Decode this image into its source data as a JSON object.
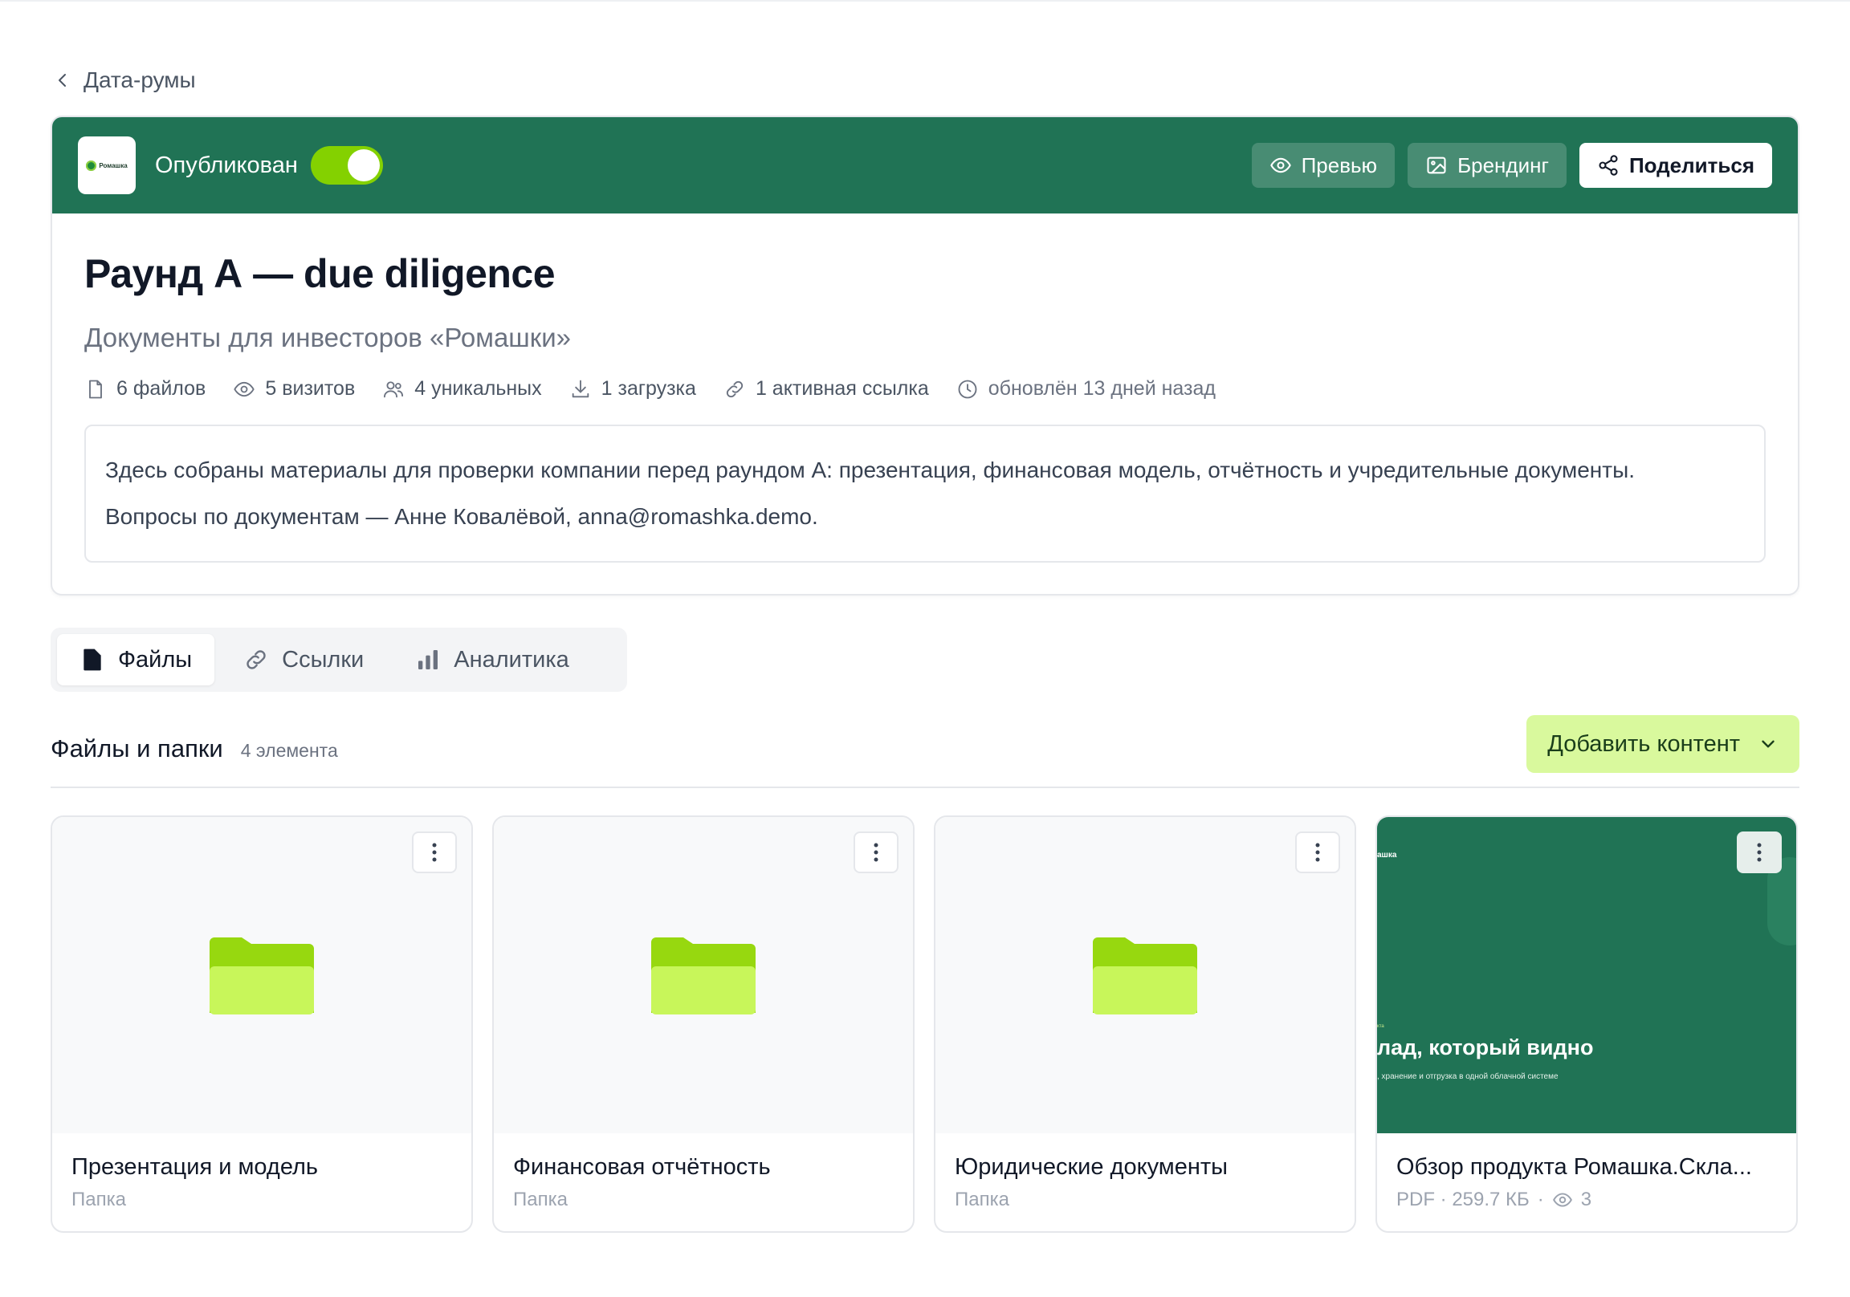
{
  "nav": {
    "back_label": "Дата-румы"
  },
  "room": {
    "logo_text": "Ромашка",
    "status_label": "Опубликован",
    "published": true,
    "actions": {
      "preview": "Превью",
      "branding": "Брендинг",
      "share": "Поделиться"
    },
    "title": "Раунд А — due diligence",
    "subtitle": "Документы для инвесторов «Ромашки»",
    "meta": {
      "files": "6 файлов",
      "visits": "5 визитов",
      "unique": "4 уникальных",
      "downloads": "1 загрузка",
      "links": "1 активная ссылка",
      "updated": "обновлён 13 дней назад"
    },
    "description": [
      "Здесь собраны материалы для проверки компании перед раундом А: презентация, финансовая модель, отчётность и учредительные документы.",
      "Вопросы по документам — Анне Ковалёвой, anna@romashka.demo."
    ]
  },
  "tabs": [
    {
      "label": "Файлы",
      "active": true
    },
    {
      "label": "Ссылки",
      "active": false
    },
    {
      "label": "Аналитика",
      "active": false
    }
  ],
  "section": {
    "title": "Файлы и папки",
    "count": "4 элемента",
    "add_button": "Добавить контент"
  },
  "items": [
    {
      "name": "Презентация и модель",
      "type": "Папка"
    },
    {
      "name": "Финансовая отчётность",
      "type": "Папка"
    },
    {
      "name": "Юридические документы",
      "type": "Папка"
    },
    {
      "name": "Обзор продукта Ромашка.Скла...",
      "meta": "PDF · 259.7 КБ",
      "views": "3",
      "preview": {
        "brand": "ашка",
        "eyebrow": "кта",
        "headline": "лад, который видно",
        "tagline": ", хранение и отгрузка в одной облачной системе"
      }
    }
  ],
  "colors": {
    "brand_green": "#207355",
    "toggle_on": "#84d100",
    "accent_lime": "#d9f99d",
    "folder_tab": "#97d80f",
    "folder_body": "#c8f65a"
  }
}
